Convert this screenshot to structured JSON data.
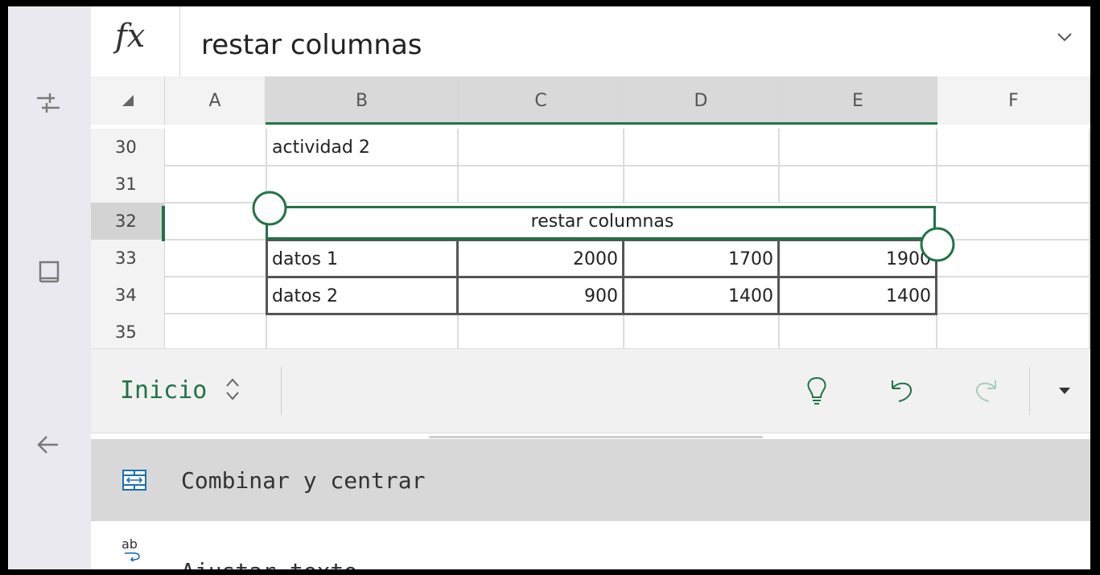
{
  "formula_bar": {
    "fx_label": "fx",
    "value": "restar columnas"
  },
  "columns": [
    "A",
    "B",
    "C",
    "D",
    "E",
    "F"
  ],
  "rows": [
    {
      "num": "30",
      "cells": {
        "B": "actividad 2"
      }
    },
    {
      "num": "31",
      "cells": {}
    },
    {
      "num": "32",
      "cells": {
        "merged_BE": "restar columnas"
      }
    },
    {
      "num": "33",
      "cells": {
        "B": "datos 1",
        "C": "2000",
        "D": "1700",
        "E": "1900"
      }
    },
    {
      "num": "34",
      "cells": {
        "B": "datos 2",
        "C": "900",
        "D": "1400",
        "E": "1400"
      }
    },
    {
      "num": "35",
      "cells": {}
    }
  ],
  "selected_row": "32",
  "selected_columns": [
    "B",
    "C",
    "D",
    "E"
  ],
  "ribbon": {
    "tab_label": "Inicio",
    "buttons": [
      "lightbulb-icon",
      "undo-icon",
      "redo-icon",
      "dropdown-arrow-icon"
    ]
  },
  "commands": [
    {
      "label": "Combinar y centrar",
      "icon": "merge-center-icon",
      "highlighted": true
    },
    {
      "label": "Ajustar texto",
      "icon": "wrap-text-icon",
      "highlighted": false
    }
  ],
  "colors": {
    "accent": "#217346",
    "header_bg": "#f3f3f3",
    "selected_header_bg": "#d9d9d9",
    "highlight_bg": "#d8d8d8"
  }
}
